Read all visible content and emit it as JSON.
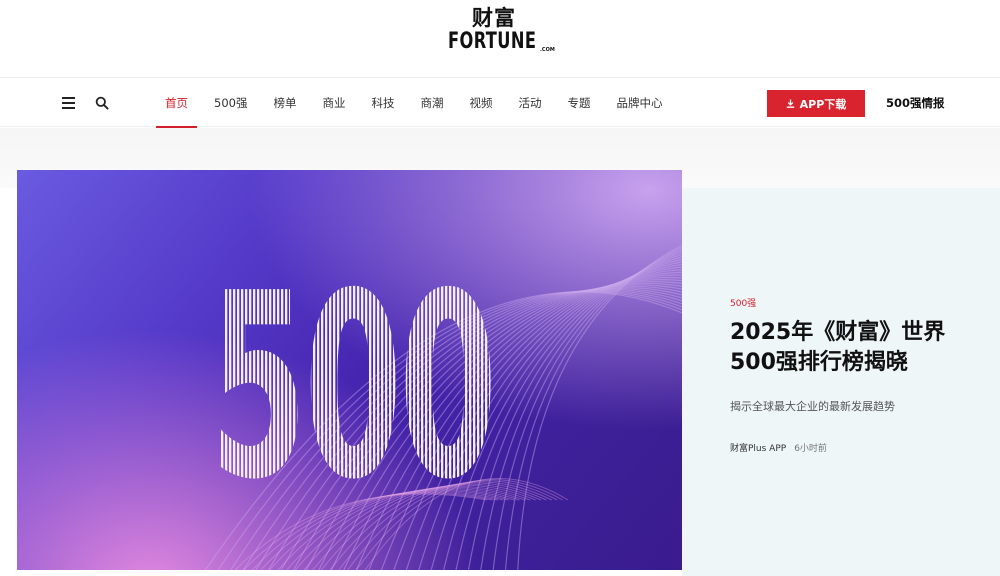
{
  "brand": {
    "logo_cn": "财富",
    "logo_en": "FORTUNE",
    "logo_com": ".COM"
  },
  "nav": {
    "items": [
      {
        "label": "首页",
        "active": true
      },
      {
        "label": "500强",
        "active": false
      },
      {
        "label": "榜单",
        "active": false
      },
      {
        "label": "商业",
        "active": false
      },
      {
        "label": "科技",
        "active": false
      },
      {
        "label": "商潮",
        "active": false
      },
      {
        "label": "视频",
        "active": false
      },
      {
        "label": "活动",
        "active": false
      },
      {
        "label": "专题",
        "active": false
      },
      {
        "label": "品牌中心",
        "active": false
      }
    ],
    "app_button": "APP下载",
    "report_link": "500强情报"
  },
  "hero": {
    "image_text": "500",
    "category": "500强",
    "headline": "2025年《财富》世界500强排行榜揭晓",
    "subtitle": "揭示全球最大企业的最新发展趋势",
    "source": "财富Plus APP",
    "time": "6小时前"
  },
  "colors": {
    "accent": "#d21f2b",
    "hero_panel": "#eef6f8",
    "image_purple": "#4423ac"
  },
  "icons": {
    "menu": "menu-icon",
    "search": "search-icon",
    "download": "download-icon"
  }
}
